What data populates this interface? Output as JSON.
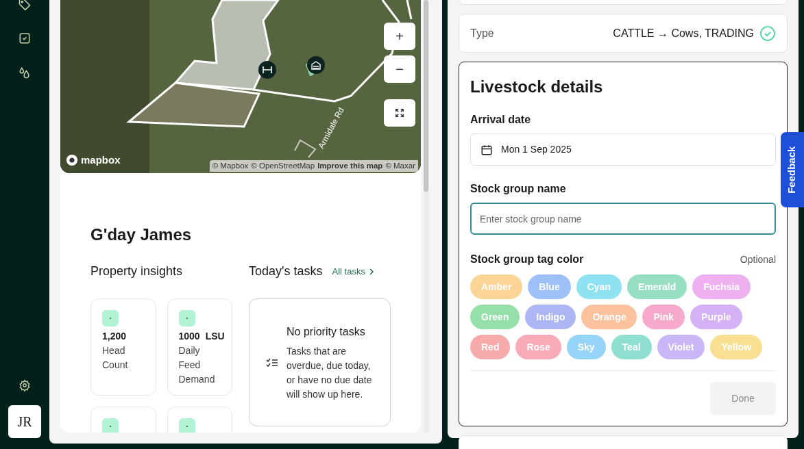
{
  "sidebar": {
    "avatar": "JR"
  },
  "map": {
    "road_label": "Armidale Rd",
    "logo": "mapbox",
    "attribution": [
      {
        "text": "© Mapbox",
        "bold": false
      },
      {
        "text": "© OpenStreetMap",
        "bold": false
      },
      {
        "text": "Improve this map",
        "bold": true
      },
      {
        "text": "© Maxar",
        "bold": false
      }
    ],
    "zoom_in": "+",
    "zoom_out": "−"
  },
  "greeting": "G'day James",
  "insights": {
    "title": "Property insights",
    "cards": [
      {
        "kind": "stat",
        "value": "1,200",
        "label": "Head Count"
      },
      {
        "kind": "stat",
        "value": "1000",
        "unit": "LSU",
        "label": "Daily Feed Demand"
      },
      {
        "kind": "cut_off"
      },
      {
        "kind": "cut_off"
      }
    ]
  },
  "tasks": {
    "title": "Today's tasks",
    "link": "All tasks",
    "empty_title": "No priority tasks",
    "empty_text": "Tasks that are overdue, due today, or have no due date will show up here."
  },
  "type_row": {
    "label": "Type",
    "value": "CATTLE → Cows, TRADING",
    "confirmed": true
  },
  "livestock": {
    "title": "Livestock details",
    "arrival_label": "Arrival date",
    "arrival_value": "Mon 1 Sep 2025",
    "name_label": "Stock group name",
    "name_placeholder": "Enter stock group name",
    "tag_label": "Stock group tag color",
    "tag_hint": "Optional",
    "tags": [
      {
        "label": "Amber",
        "color": "#fcd596"
      },
      {
        "label": "Blue",
        "color": "#9cc0f7"
      },
      {
        "label": "Cyan",
        "color": "#8ee2f2"
      },
      {
        "label": "Emerald",
        "color": "#97dfc3"
      },
      {
        "label": "Fuchsia",
        "color": "#efb0f2"
      },
      {
        "label": "Green",
        "color": "#95dfa9"
      },
      {
        "label": "Indigo",
        "color": "#adb6f4"
      },
      {
        "label": "Orange",
        "color": "#fbc29d"
      },
      {
        "label": "Pink",
        "color": "#f6a9cb"
      },
      {
        "label": "Purple",
        "color": "#d5b2f5"
      },
      {
        "label": "Red",
        "color": "#f6aaaa"
      },
      {
        "label": "Rose",
        "color": "#f8aab7"
      },
      {
        "label": "Sky",
        "color": "#95d4f6"
      },
      {
        "label": "Teal",
        "color": "#8fdfd1"
      },
      {
        "label": "Violet",
        "color": "#c8b6f7"
      },
      {
        "label": "Yellow",
        "color": "#f8df92"
      }
    ],
    "done": "Done",
    "done_disabled": true
  },
  "feedback": "Feedback"
}
